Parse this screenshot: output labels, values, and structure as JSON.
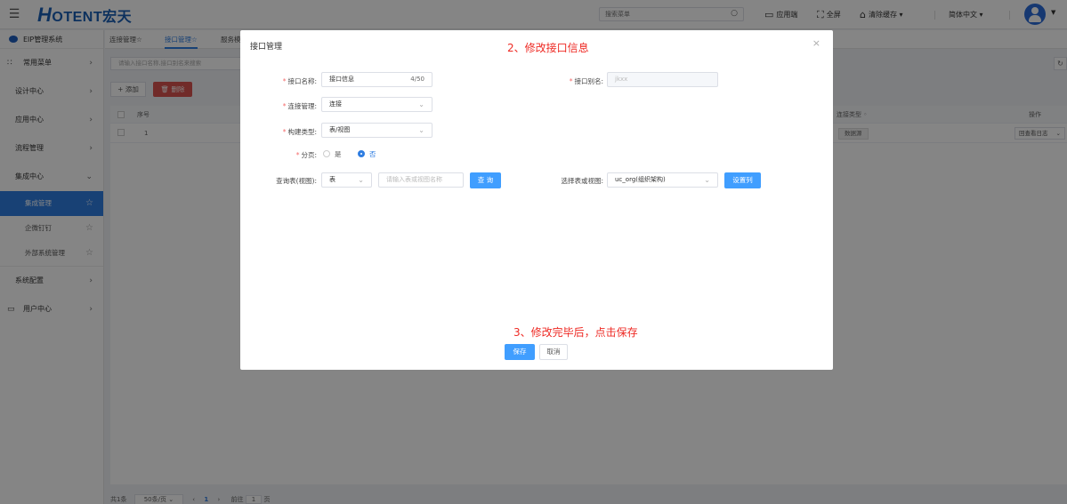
{
  "header": {
    "logo_text": "OTENT宏天",
    "logo_letter": "H",
    "search_placeholder": "搜索菜单",
    "app_button": "应用端",
    "fullscreen": "全屏",
    "clear_cache": "清除缓存",
    "language": "简体中文"
  },
  "sidebar": {
    "system_title": "EIP管理系统",
    "items": [
      {
        "label": "常用菜单"
      },
      {
        "label": "设计中心"
      },
      {
        "label": "应用中心"
      },
      {
        "label": "流程管理"
      },
      {
        "label": "集成中心"
      }
    ],
    "subitems": [
      {
        "label": "集成管理"
      },
      {
        "label": "企微钉钉"
      },
      {
        "label": "外部系统管理"
      }
    ],
    "bottom_items": [
      {
        "label": "系统配置"
      },
      {
        "label": "用户中心"
      }
    ]
  },
  "tabs": [
    {
      "label": "连接管理☆"
    },
    {
      "label": "接口管理☆"
    },
    {
      "label": "服务模"
    }
  ],
  "main": {
    "search_placeholder": "请输入接口名称,接口别名来搜索",
    "add_label": "+ 添加",
    "delete_label": "删除",
    "columns": {
      "index": "序号",
      "conn_type": "连接类型",
      "ops": "操作"
    },
    "rows": [
      {
        "index": "1",
        "conn_type": "数据源",
        "op": "回查看日志"
      }
    ],
    "pager": {
      "total": "共1条",
      "page_size": "50条/页",
      "current": "1",
      "goto_label": "前往",
      "goto_value": "1",
      "page_unit": "页"
    }
  },
  "modal": {
    "title": "接口管理",
    "close": "×",
    "annotation_top": "2、修改接口信息",
    "annotation_bottom": "3、修改完毕后，点击保存",
    "fields": {
      "name_label": "接口名称:",
      "name_value": "接口信息",
      "name_count": "4/50",
      "alias_label": "接口别名:",
      "alias_value": "jkxx",
      "conn_label": "连接管理:",
      "conn_value": "连接",
      "build_label": "构建类型:",
      "build_value": "表/视图",
      "page_label": "分页:",
      "page_yes": "是",
      "page_no": "否",
      "query_label": "查询表(视图):",
      "query_type": "表",
      "query_placeholder": "请输入表或视图名称",
      "query_button": "查 询",
      "select_label": "选择表或视图:",
      "select_value": "uc_org(组织架构)",
      "set_col_button": "设置列"
    },
    "save": "保存",
    "cancel": "取消"
  }
}
